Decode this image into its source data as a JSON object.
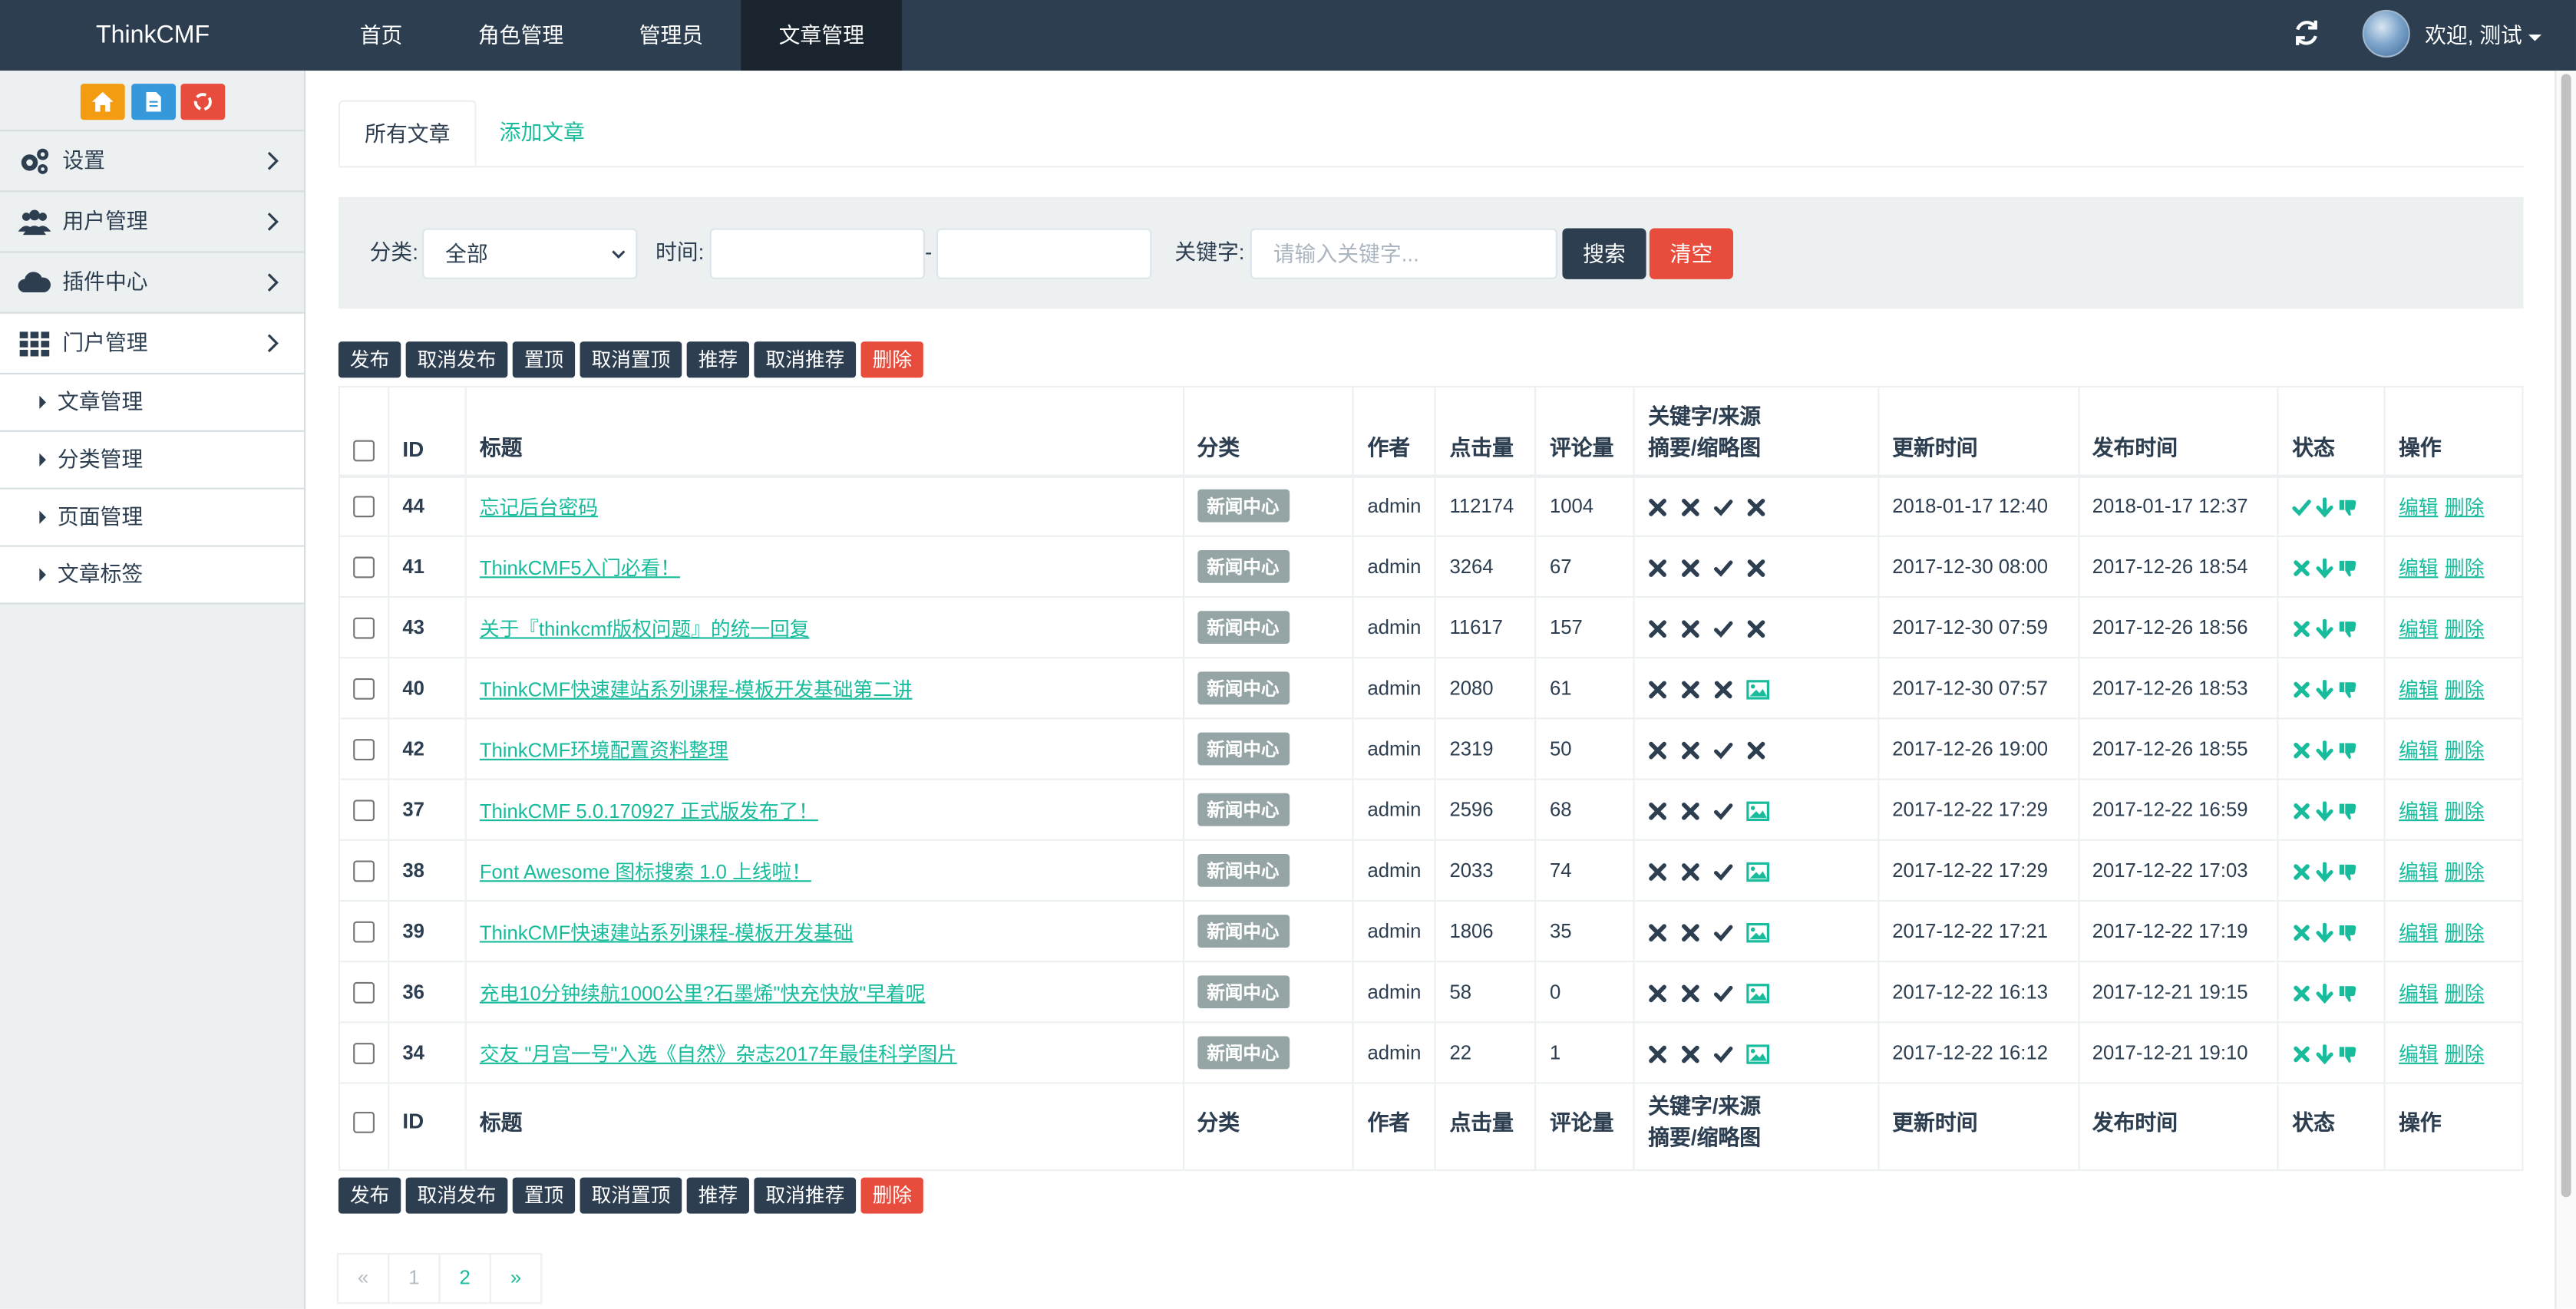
{
  "brand": "ThinkCMF",
  "nav": [
    "首页",
    "角色管理",
    "管理员",
    "文章管理"
  ],
  "user": {
    "welcome": "欢迎, 测试"
  },
  "sidebar": {
    "menu": [
      "设置",
      "用户管理",
      "插件中心",
      "门户管理"
    ],
    "submenu": [
      "文章管理",
      "分类管理",
      "页面管理",
      "文章标签"
    ]
  },
  "tabs": {
    "all": "所有文章",
    "add": "添加文章"
  },
  "filter": {
    "category_label": "分类:",
    "category_value": "全部",
    "time_label": "时间:",
    "time_sep": "-",
    "keyword_label": "关键字:",
    "keyword_placeholder": "请输入关键字...",
    "search": "搜索",
    "clear": "清空"
  },
  "actions": [
    "发布",
    "取消发布",
    "置顶",
    "取消置顶",
    "推荐",
    "取消推荐",
    "删除"
  ],
  "table": {
    "headers": {
      "id": "ID",
      "title": "标题",
      "category": "分类",
      "author": "作者",
      "hits": "点击量",
      "comments": "评论量",
      "kw1": "关键字/来源",
      "kw2": "摘要/缩略图",
      "updated": "更新时间",
      "published": "发布时间",
      "status": "状态",
      "ops": "操作"
    },
    "rows": [
      {
        "id": "44",
        "title": "忘记后台密码",
        "category": "新闻中心",
        "author": "admin",
        "hits": "112174",
        "comments": "1004",
        "flags": [
          "x",
          "x",
          "check",
          "x"
        ],
        "updated": "2018-01-17 12:40",
        "published": "2018-01-17 12:37",
        "status": "check"
      },
      {
        "id": "41",
        "title": "ThinkCMF5入门必看！",
        "category": "新闻中心",
        "author": "admin",
        "hits": "3264",
        "comments": "67",
        "flags": [
          "x",
          "x",
          "check",
          "x"
        ],
        "updated": "2017-12-30 08:00",
        "published": "2017-12-26 18:54",
        "status": "x"
      },
      {
        "id": "43",
        "title": "关于『thinkcmf版权问题』的统一回复",
        "category": "新闻中心",
        "author": "admin",
        "hits": "11617",
        "comments": "157",
        "flags": [
          "x",
          "x",
          "check",
          "x"
        ],
        "updated": "2017-12-30 07:59",
        "published": "2017-12-26 18:56",
        "status": "x"
      },
      {
        "id": "40",
        "title": "ThinkCMF快速建站系列课程-模板开发基础第二讲",
        "category": "新闻中心",
        "author": "admin",
        "hits": "2080",
        "comments": "61",
        "flags": [
          "x",
          "x",
          "x",
          "img"
        ],
        "updated": "2017-12-30 07:57",
        "published": "2017-12-26 18:53",
        "status": "x"
      },
      {
        "id": "42",
        "title": "ThinkCMF环境配置资料整理",
        "category": "新闻中心",
        "author": "admin",
        "hits": "2319",
        "comments": "50",
        "flags": [
          "x",
          "x",
          "check",
          "x"
        ],
        "updated": "2017-12-26 19:00",
        "published": "2017-12-26 18:55",
        "status": "x"
      },
      {
        "id": "37",
        "title": "ThinkCMF 5.0.170927 正式版发布了！",
        "category": "新闻中心",
        "author": "admin",
        "hits": "2596",
        "comments": "68",
        "flags": [
          "x",
          "x",
          "check",
          "img"
        ],
        "updated": "2017-12-22 17:29",
        "published": "2017-12-22 16:59",
        "status": "x"
      },
      {
        "id": "38",
        "title": "Font Awesome 图标搜索 1.0 上线啦！",
        "category": "新闻中心",
        "author": "admin",
        "hits": "2033",
        "comments": "74",
        "flags": [
          "x",
          "x",
          "check",
          "img"
        ],
        "updated": "2017-12-22 17:29",
        "published": "2017-12-22 17:03",
        "status": "x"
      },
      {
        "id": "39",
        "title": "ThinkCMF快速建站系列课程-模板开发基础",
        "category": "新闻中心",
        "author": "admin",
        "hits": "1806",
        "comments": "35",
        "flags": [
          "x",
          "x",
          "check",
          "img"
        ],
        "updated": "2017-12-22 17:21",
        "published": "2017-12-22 17:19",
        "status": "x"
      },
      {
        "id": "36",
        "title": "充电10分钟续航1000公里?石墨烯\"快充快放\"早着呢",
        "category": "新闻中心",
        "author": "admin",
        "hits": "58",
        "comments": "0",
        "flags": [
          "x",
          "x",
          "check",
          "img"
        ],
        "updated": "2017-12-22 16:13",
        "published": "2017-12-21 19:15",
        "status": "x"
      },
      {
        "id": "34",
        "title": "交友 \"月宫一号\"入选《自然》杂志2017年最佳科学图片",
        "category": "新闻中心",
        "author": "admin",
        "hits": "22",
        "comments": "1",
        "flags": [
          "x",
          "x",
          "check",
          "img"
        ],
        "updated": "2017-12-22 16:12",
        "published": "2017-12-21 19:10",
        "status": "x"
      }
    ],
    "op_edit": "编辑",
    "op_delete": "删除"
  },
  "pagination": [
    "«",
    "1",
    "2",
    "»"
  ],
  "colors": {
    "navbar": "#2c3e50",
    "accent": "#18bc9c",
    "danger": "#e74c3c",
    "badge": "#95a5a6",
    "sidebar": "#ecf0f1"
  }
}
